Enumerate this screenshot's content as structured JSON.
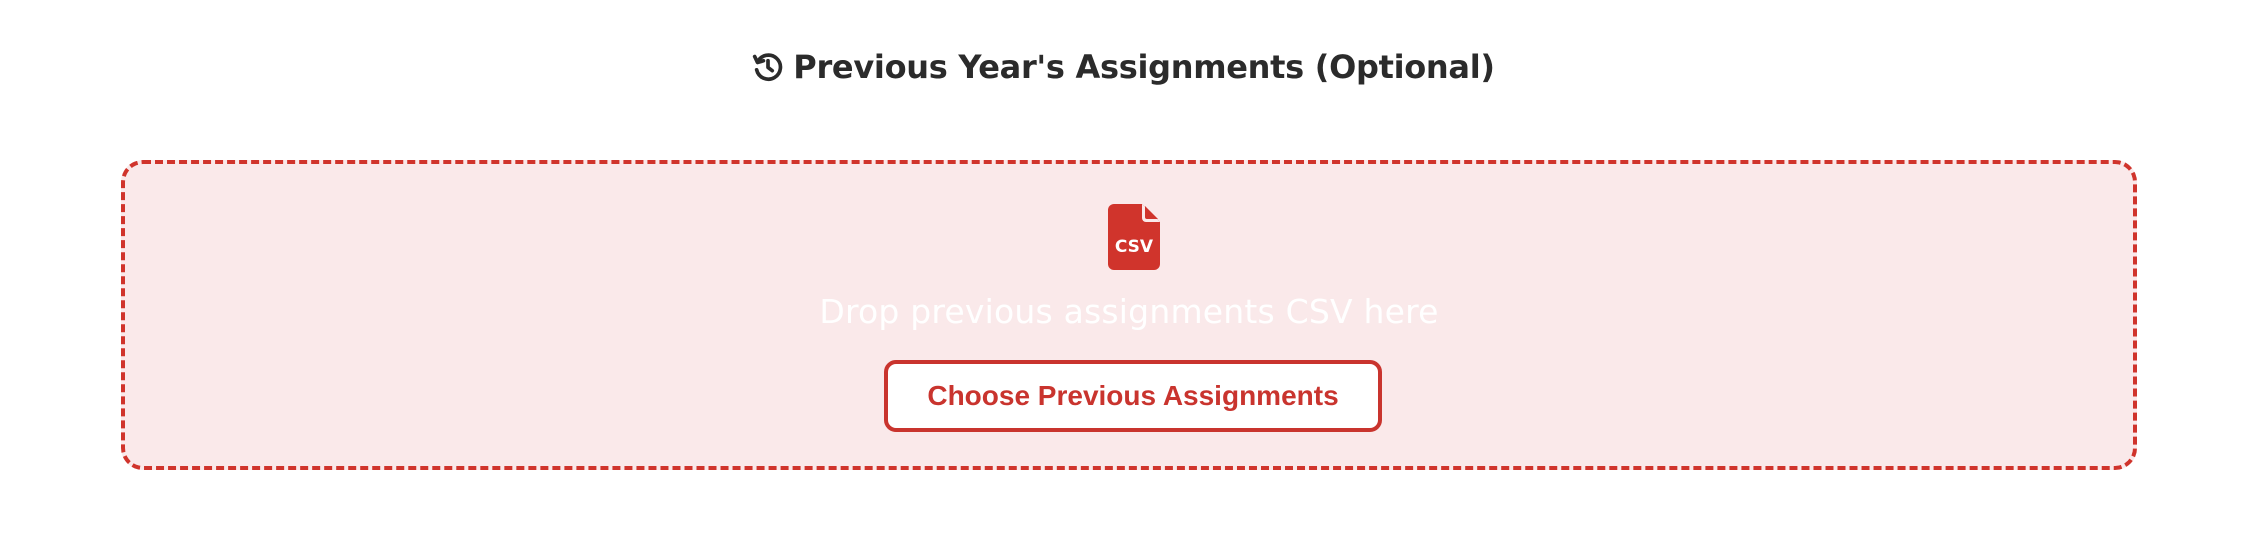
{
  "section": {
    "title": "Previous Year's Assignments (Optional)",
    "icon": "history-icon"
  },
  "dropzone": {
    "icon": "csv-file-icon",
    "icon_label": "CSV",
    "prompt": "Drop previous assignments CSV here",
    "button_label": "Choose Previous Assignments"
  },
  "colors": {
    "accent": "#d0342c",
    "dropzone_background": "#fae9ea",
    "title_text": "#2b2b2b"
  }
}
